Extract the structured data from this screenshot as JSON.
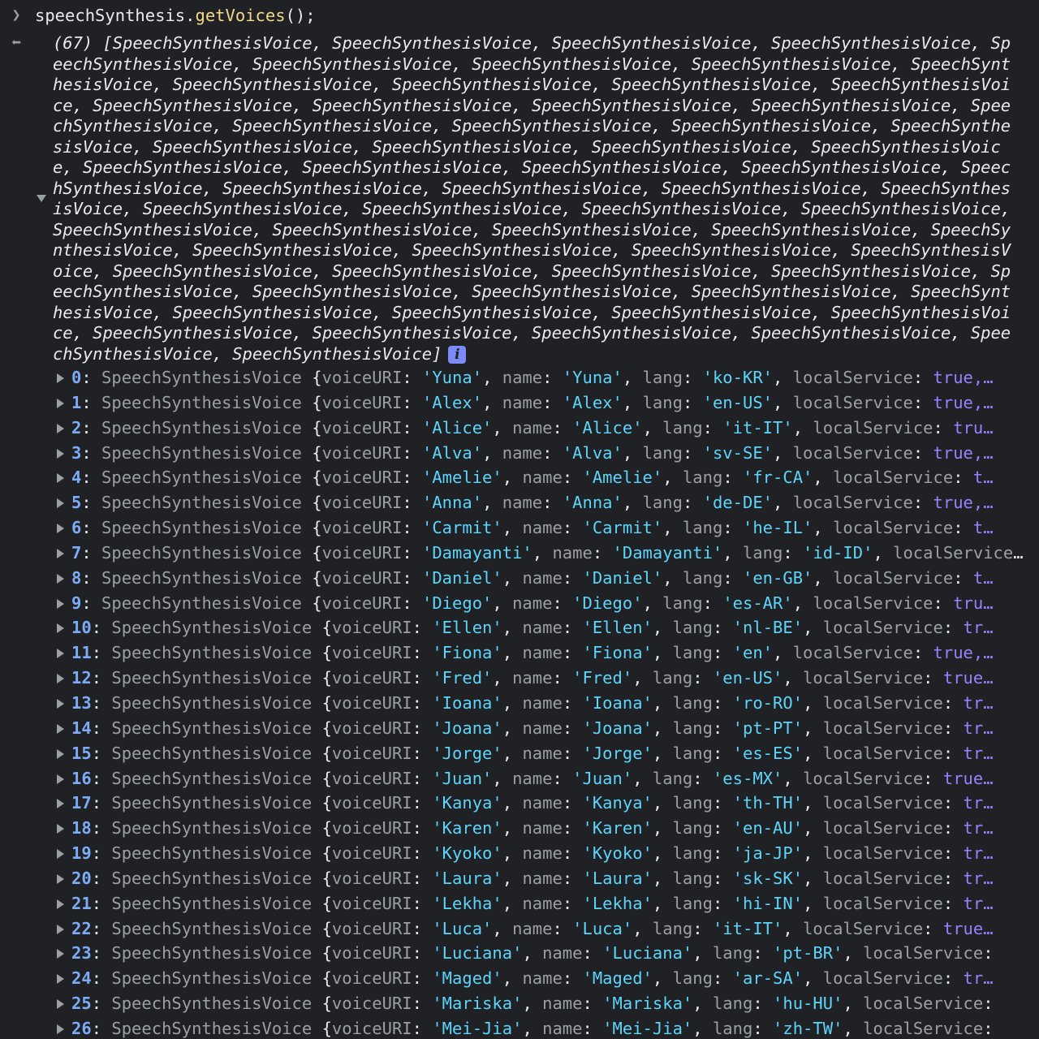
{
  "console": {
    "input": {
      "object": "speechSynthesis",
      "dot": ".",
      "method": "getVoices",
      "args": "();"
    },
    "summary": {
      "text": "(67) [SpeechSynthesisVoice, SpeechSynthesisVoice, SpeechSynthesisVoice, SpeechSynthesisVoice, SpeechSynthesisVoice, SpeechSynthesisVoice, SpeechSynthesisVoice, SpeechSynthesisVoice, SpeechSynthesisVoice, SpeechSynthesisVoice, SpeechSynthesisVoice, SpeechSynthesisVoice, SpeechSynthesisVoice, SpeechSynthesisVoice, SpeechSynthesisVoice, SpeechSynthesisVoice, SpeechSynthesisVoice, SpeechSynthesisVoice, SpeechSynthesisVoice, SpeechSynthesisVoice, SpeechSynthesisVoice, SpeechSynthesisVoice, SpeechSynthesisVoice, SpeechSynthesisVoice, SpeechSynthesisVoice, SpeechSynthesisVoice, SpeechSynthesisVoice, SpeechSynthesisVoice, SpeechSynthesisVoice, SpeechSynthesisVoice, SpeechSynthesisVoice, SpeechSynthesisVoice, SpeechSynthesisVoice, SpeechSynthesisVoice, SpeechSynthesisVoice, SpeechSynthesisVoice, SpeechSynthesisVoice, SpeechSynthesisVoice, SpeechSynthesisVoice, SpeechSynthesisVoice, SpeechSynthesisVoice, SpeechSynthesisVoice, SpeechSynthesisVoice, SpeechSynthesisVoice, SpeechSynthesisVoice, SpeechSynthesisVoice, SpeechSynthesisVoice, SpeechSynthesisVoice, SpeechSynthesisVoice, SpeechSynthesisVoice, SpeechSynthesisVoice, SpeechSynthesisVoice, SpeechSynthesisVoice, SpeechSynthesisVoice, SpeechSynthesisVoice, SpeechSynthesisVoice, SpeechSynthesisVoice, SpeechSynthesisVoice, SpeechSynthesisVoice, SpeechSynthesisVoice, SpeechSynthesisVoice, SpeechSynthesisVoice, SpeechSynthesisVoice, SpeechSynthesisVoice, SpeechSynthesisVoice, SpeechSynthesisVoice, SpeechSynthesisVoice]",
      "info_badge": "i"
    },
    "class_name": "SpeechSynthesisVoice",
    "key_voiceURI": "voiceURI",
    "key_name": "name",
    "key_lang": "lang",
    "key_localService": "localService",
    "local_true": "true",
    "items": [
      {
        "index": "0",
        "voiceURI": "'Yuna'",
        "name": "'Yuna'",
        "lang": "'ko-KR'",
        "tail": "true,…"
      },
      {
        "index": "1",
        "voiceURI": "'Alex'",
        "name": "'Alex'",
        "lang": "'en-US'",
        "tail": "true,…"
      },
      {
        "index": "2",
        "voiceURI": "'Alice'",
        "name": "'Alice'",
        "lang": "'it-IT'",
        "tail": "tru…"
      },
      {
        "index": "3",
        "voiceURI": "'Alva'",
        "name": "'Alva'",
        "lang": "'sv-SE'",
        "tail": "true,…"
      },
      {
        "index": "4",
        "voiceURI": "'Amelie'",
        "name": "'Amelie'",
        "lang": "'fr-CA'",
        "tail": "t…"
      },
      {
        "index": "5",
        "voiceURI": "'Anna'",
        "name": "'Anna'",
        "lang": "'de-DE'",
        "tail": "true,…"
      },
      {
        "index": "6",
        "voiceURI": "'Carmit'",
        "name": "'Carmit'",
        "lang": "'he-IL'",
        "tail": "t…"
      },
      {
        "index": "7",
        "voiceURI": "'Damayanti'",
        "name": "'Damayanti'",
        "lang": "'id-ID'",
        "tail": ""
      },
      {
        "index": "8",
        "voiceURI": "'Daniel'",
        "name": "'Daniel'",
        "lang": "'en-GB'",
        "tail": "t…"
      },
      {
        "index": "9",
        "voiceURI": "'Diego'",
        "name": "'Diego'",
        "lang": "'es-AR'",
        "tail": "tru…"
      },
      {
        "index": "10",
        "voiceURI": "'Ellen'",
        "name": "'Ellen'",
        "lang": "'nl-BE'",
        "tail": "tr…"
      },
      {
        "index": "11",
        "voiceURI": "'Fiona'",
        "name": "'Fiona'",
        "lang": "'en'",
        "tail": "true,…"
      },
      {
        "index": "12",
        "voiceURI": "'Fred'",
        "name": "'Fred'",
        "lang": "'en-US'",
        "tail": "true…"
      },
      {
        "index": "13",
        "voiceURI": "'Ioana'",
        "name": "'Ioana'",
        "lang": "'ro-RO'",
        "tail": "tr…"
      },
      {
        "index": "14",
        "voiceURI": "'Joana'",
        "name": "'Joana'",
        "lang": "'pt-PT'",
        "tail": "tr…"
      },
      {
        "index": "15",
        "voiceURI": "'Jorge'",
        "name": "'Jorge'",
        "lang": "'es-ES'",
        "tail": "tr…"
      },
      {
        "index": "16",
        "voiceURI": "'Juan'",
        "name": "'Juan'",
        "lang": "'es-MX'",
        "tail": "true…"
      },
      {
        "index": "17",
        "voiceURI": "'Kanya'",
        "name": "'Kanya'",
        "lang": "'th-TH'",
        "tail": "tr…"
      },
      {
        "index": "18",
        "voiceURI": "'Karen'",
        "name": "'Karen'",
        "lang": "'en-AU'",
        "tail": "tr…"
      },
      {
        "index": "19",
        "voiceURI": "'Kyoko'",
        "name": "'Kyoko'",
        "lang": "'ja-JP'",
        "tail": "tr…"
      },
      {
        "index": "20",
        "voiceURI": "'Laura'",
        "name": "'Laura'",
        "lang": "'sk-SK'",
        "tail": "tr…"
      },
      {
        "index": "21",
        "voiceURI": "'Lekha'",
        "name": "'Lekha'",
        "lang": "'hi-IN'",
        "tail": "tr…"
      },
      {
        "index": "22",
        "voiceURI": "'Luca'",
        "name": "'Luca'",
        "lang": "'it-IT'",
        "tail": "true…"
      },
      {
        "index": "23",
        "voiceURI": "'Luciana'",
        "name": "'Luciana'",
        "lang": "'pt-BR'",
        "tail": ""
      },
      {
        "index": "24",
        "voiceURI": "'Maged'",
        "name": "'Maged'",
        "lang": "'ar-SA'",
        "tail": "tr…"
      },
      {
        "index": "25",
        "voiceURI": "'Mariska'",
        "name": "'Mariska'",
        "lang": "'hu-HU'",
        "tail": ""
      },
      {
        "index": "26",
        "voiceURI": "'Mei-Jia'",
        "name": "'Mei-Jia'",
        "lang": "'zh-TW'",
        "tail": ""
      }
    ],
    "colors": {
      "background": "#202124",
      "index": "#7cacf8",
      "string": "#5cd5fb",
      "boolean": "#9980ff",
      "muted": "#9aa0a6",
      "function": "#f2d98c"
    }
  }
}
